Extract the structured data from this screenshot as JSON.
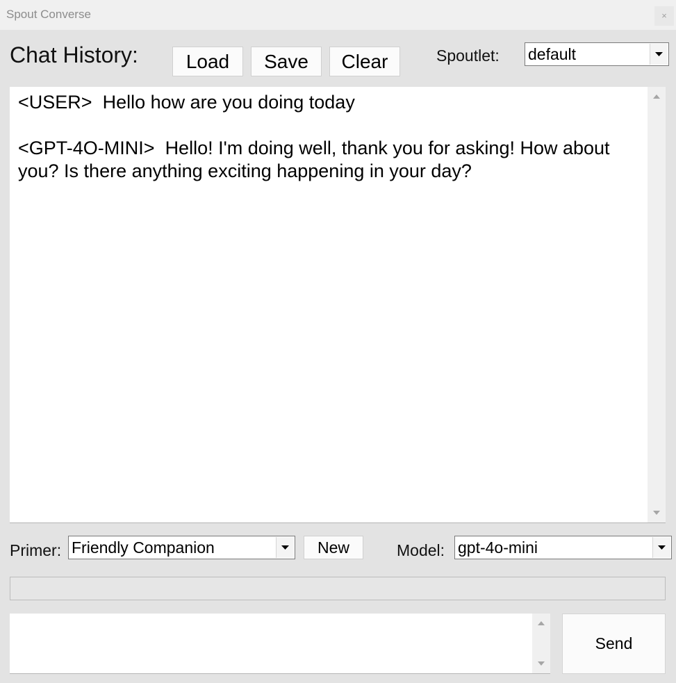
{
  "window": {
    "title": "Spout Converse",
    "close_label": "×"
  },
  "header": {
    "chat_history_label": "Chat History:",
    "load_label": "Load",
    "save_label": "Save",
    "clear_label": "Clear",
    "spoutlet_label": "Spoutlet:",
    "spoutlet_value": "default"
  },
  "chat": {
    "messages": [
      {
        "speaker": "<USER>",
        "text": "Hello how are you doing today"
      },
      {
        "speaker": "<GPT-4O-MINI>",
        "text": "Hello! I'm doing well, thank you for asking! How about you? Is there anything exciting happening in your day?"
      }
    ]
  },
  "controls": {
    "primer_label": "Primer:",
    "primer_value": "Friendly Companion",
    "new_label": "New",
    "model_label": "Model:",
    "model_value": "gpt-4o-mini"
  },
  "input": {
    "value": "",
    "send_label": "Send"
  },
  "icons": {
    "close": "close-icon",
    "dropdown": "chevron-down-icon",
    "scroll_up": "scroll-up-arrow-icon",
    "scroll_down": "scroll-down-arrow-icon"
  },
  "colors": {
    "window_bg": "#e3e3e3",
    "titlebar_bg": "#f0f0f0",
    "title_text": "#8c8c8c",
    "field_bg": "#ffffff",
    "button_bg": "#fbfbfb"
  }
}
